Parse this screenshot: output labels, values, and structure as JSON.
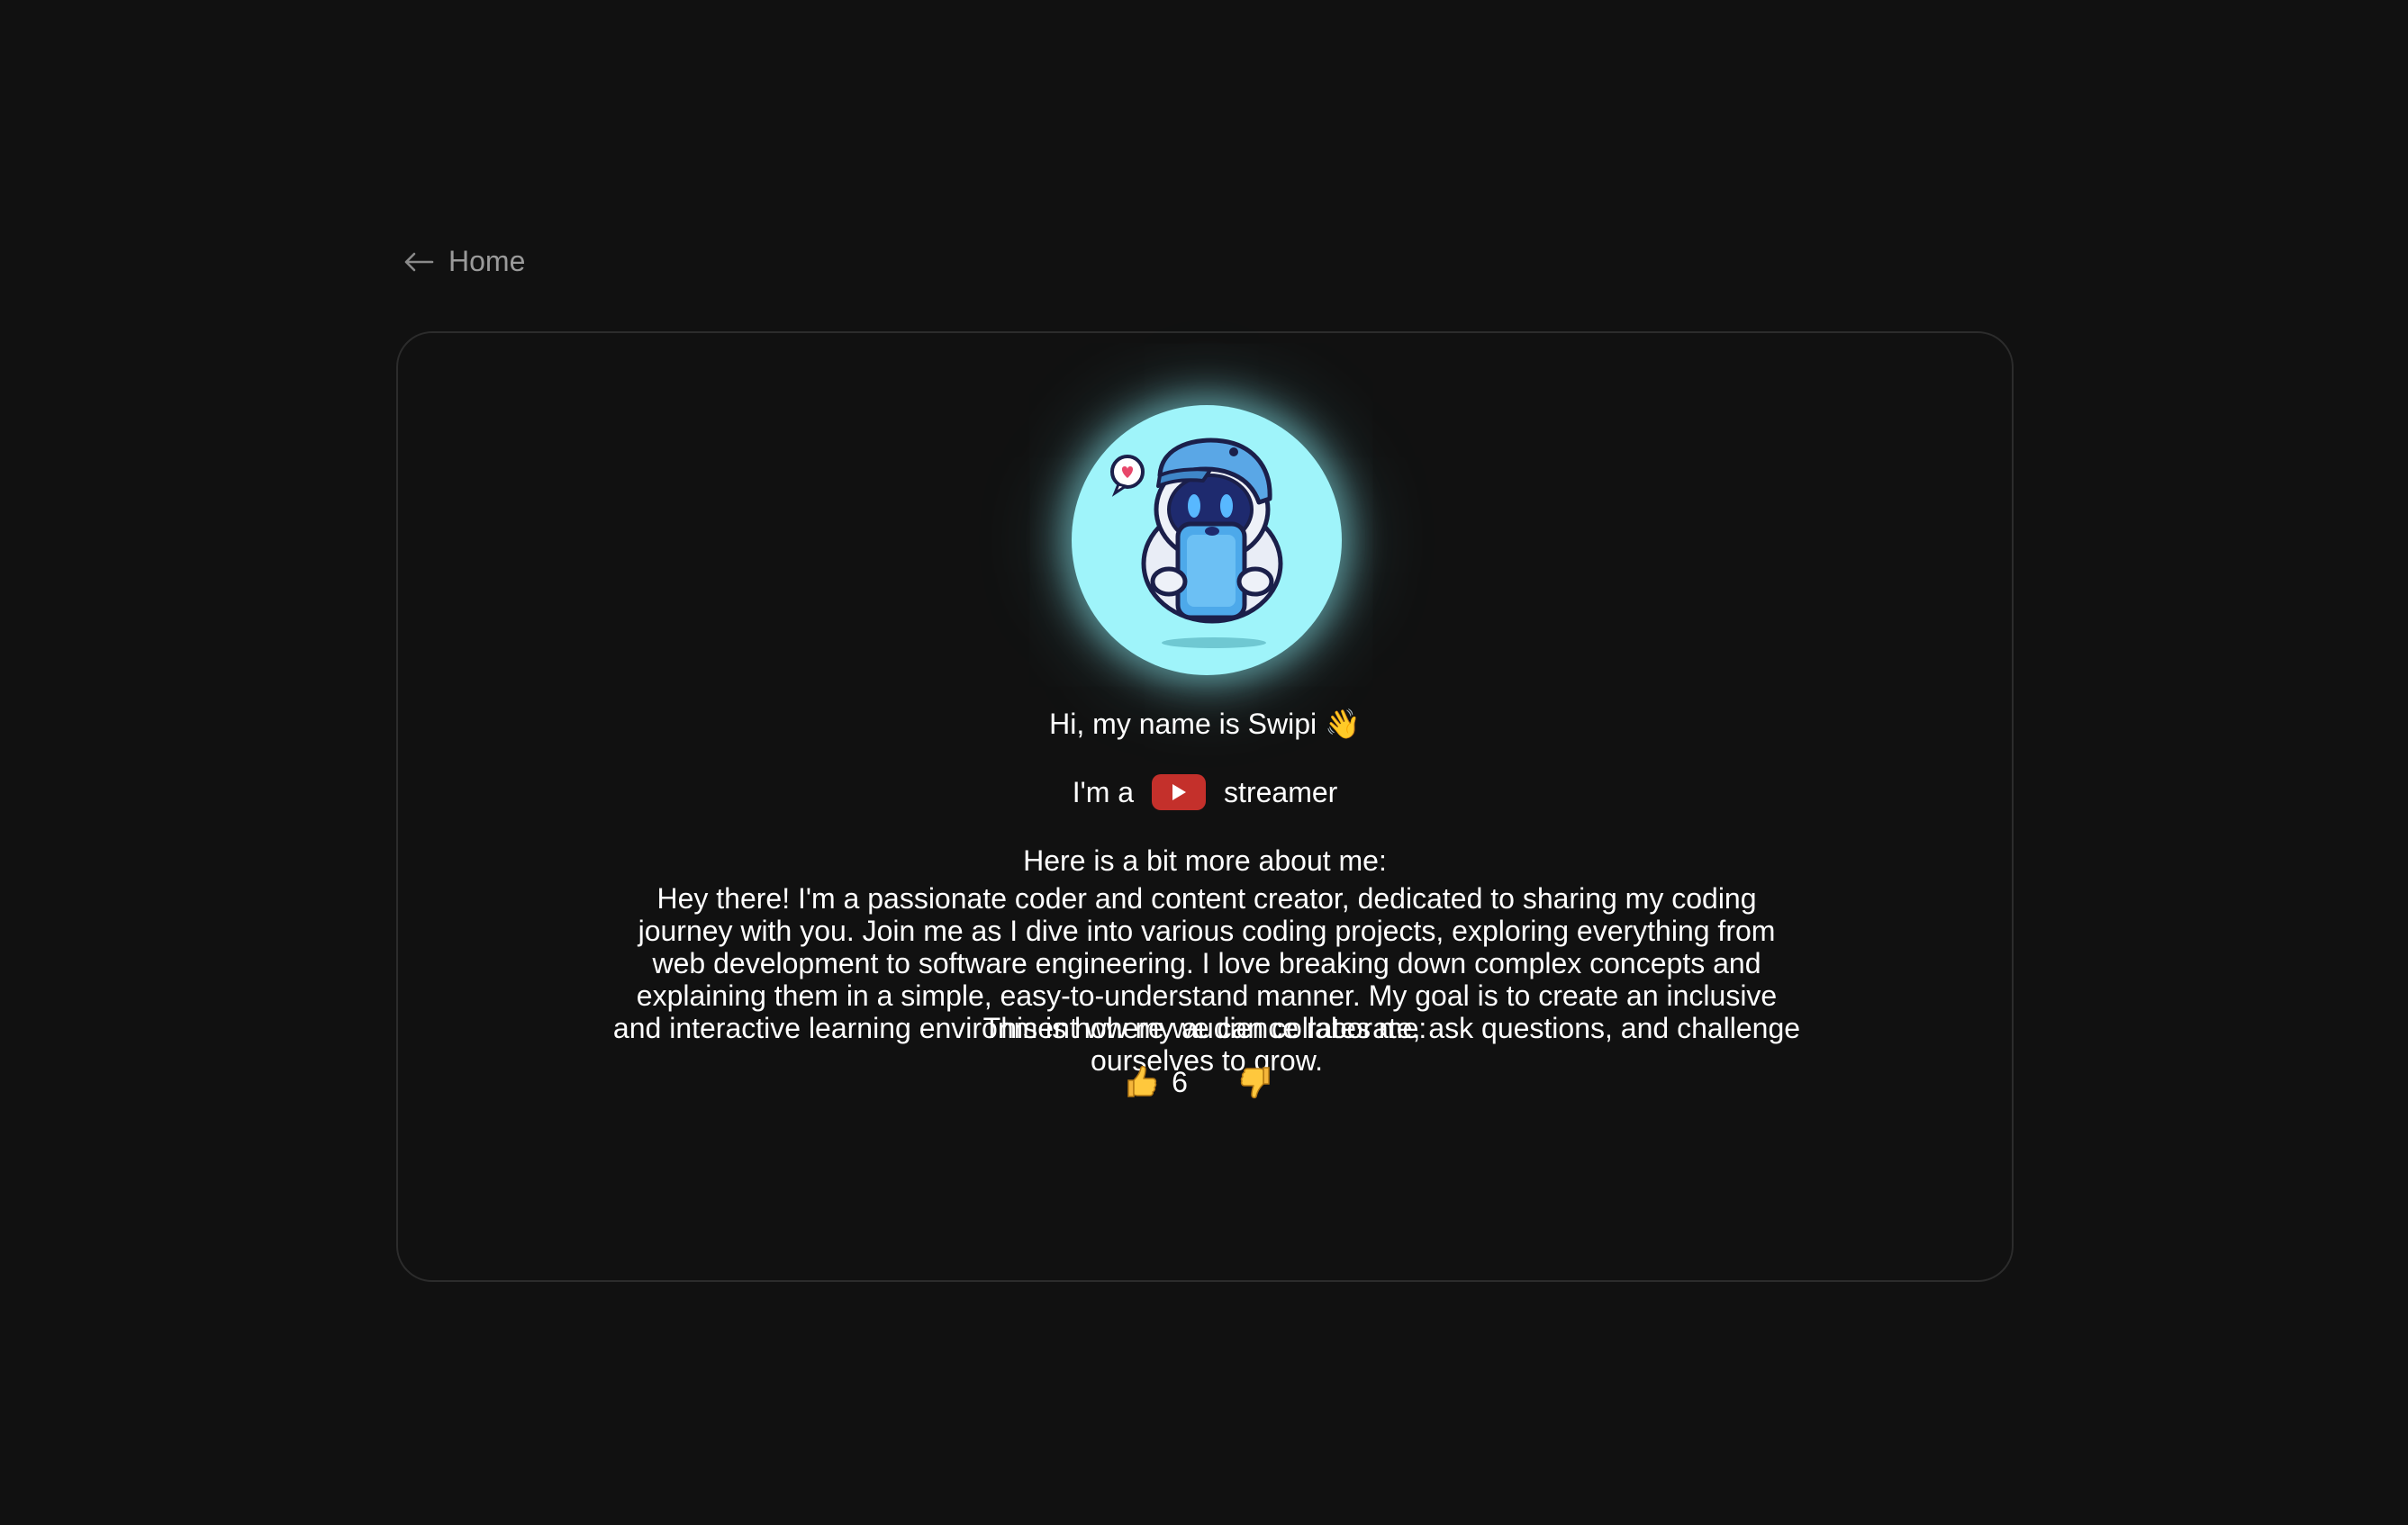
{
  "nav": {
    "back_label": "Home",
    "back_icon": "arrow-left-icon"
  },
  "profile": {
    "greeting": "Hi, my name is Swipi 👋",
    "role_prefix": "I'm a",
    "role_platform_icon": "youtube-icon",
    "role_suffix": "streamer",
    "about_heading": "Here is a bit more about me:",
    "about_text": "Hey there! I'm a passionate coder and content creator, dedicated to sharing my coding journey with you. Join me as I dive into various coding projects, exploring everything from web development to software engineering. I love breaking down complex concepts and explaining them in a simple, easy-to-understand manner. My goal is to create an inclusive and interactive learning environment where we can collaborate, ask questions, and challenge ourselves to grow.",
    "rating_heading": "This is how my audience rates me:",
    "thumbs_up_count": "6",
    "thumbs_down_count": ""
  },
  "colors": {
    "background": "#111111",
    "avatar_bg": "#9ff4fa",
    "youtube_red": "#c4302b",
    "muted_text": "#9a9a9a"
  }
}
